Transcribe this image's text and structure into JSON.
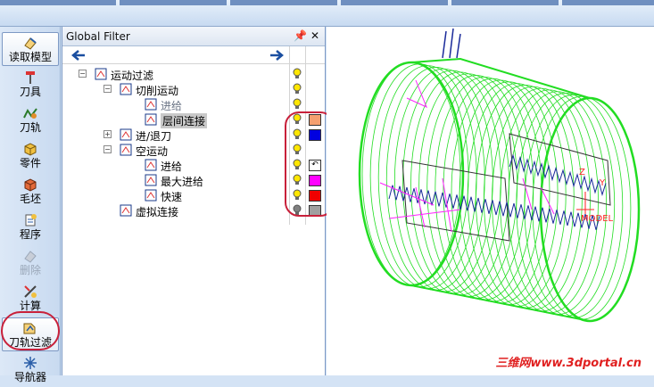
{
  "toolbar": [
    {
      "label": "读取模型",
      "icon": "load-model-icon"
    },
    {
      "label": "刀具",
      "icon": "tool-icon"
    },
    {
      "label": "刀轨",
      "icon": "toolpath-icon"
    },
    {
      "label": "零件",
      "icon": "part-icon"
    },
    {
      "label": "毛坯",
      "icon": "stock-icon"
    },
    {
      "label": "程序",
      "icon": "program-icon"
    },
    {
      "label": "删除",
      "icon": "delete-icon"
    },
    {
      "label": "计算",
      "icon": "compute-icon"
    },
    {
      "label": "刀轨过滤",
      "icon": "toolpath-filter-icon"
    },
    {
      "label": "导航器",
      "icon": "navigator-icon"
    }
  ],
  "panel": {
    "title": "Global Filter",
    "pin": "▼ 𝟰",
    "close": "✕"
  },
  "tree": [
    {
      "label": "运动过滤",
      "level": 0,
      "expander": "−",
      "bulb": "on",
      "color": ""
    },
    {
      "label": "切削运动",
      "level": 1,
      "expander": "−",
      "bulb": "on",
      "color": ""
    },
    {
      "label": "进给",
      "level": 2,
      "expander": "",
      "bulb": "on",
      "color": "",
      "gray": true
    },
    {
      "label": "层间连接",
      "level": 2,
      "expander": "",
      "bulb": "on",
      "color": "#f4a070",
      "selected": true
    },
    {
      "label": "进/退刀",
      "level": 1,
      "expander": "+",
      "bulb": "on",
      "color": "#0000e0"
    },
    {
      "label": "空运动",
      "level": 1,
      "expander": "−",
      "bulb": "on",
      "color": ""
    },
    {
      "label": "进给",
      "level": 2,
      "expander": "",
      "bulb": "on",
      "color": "icon"
    },
    {
      "label": "最大进给",
      "level": 2,
      "expander": "",
      "bulb": "on",
      "color": "#ff00ff"
    },
    {
      "label": "快速",
      "level": 2,
      "expander": "",
      "bulb": "on",
      "color": "#f00000"
    },
    {
      "label": "虚拟连接",
      "level": 1,
      "expander": "",
      "bulb": "off",
      "color": "#a0a0a0"
    }
  ],
  "viewport": {
    "axis_label": "MODEL",
    "axis_z": "Z",
    "axis_y": "Y",
    "watermark": "三维网www.3dportal.cn"
  }
}
